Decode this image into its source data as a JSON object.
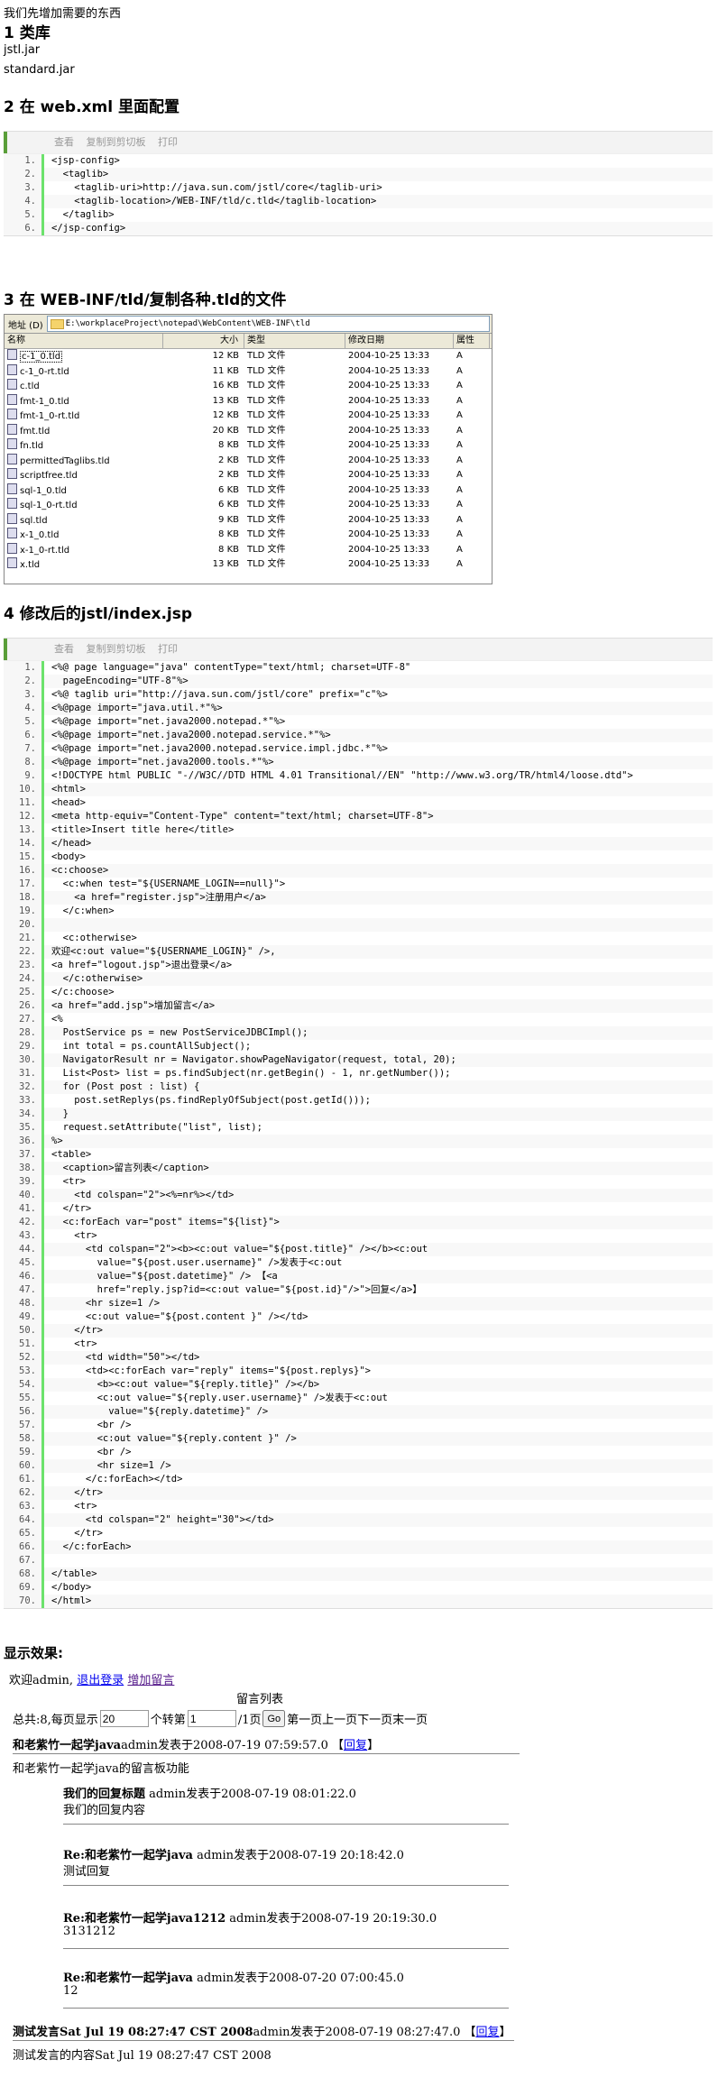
{
  "intro": "我们先增加需要的东西",
  "sec1": {
    "title": "1 类库",
    "items": [
      "jstl.jar",
      "standard.jar"
    ]
  },
  "sec2": {
    "title": "2 在 web.xml 里面配置"
  },
  "toolbar": {
    "view": "查看",
    "copy": "复制到剪切板",
    "print": "打印"
  },
  "webxml": [
    "<jsp-config>",
    "  <taglib>",
    "    <taglib-uri>http://java.sun.com/jstl/core</taglib-uri>",
    "    <taglib-location>/WEB-INF/tld/c.tld</taglib-location>",
    "  </taglib>",
    "</jsp-config>"
  ],
  "sec3": {
    "title": "3 在 WEB-INF/tld/复制各种.tld的文件"
  },
  "explorer": {
    "address_label": "地址 (D)",
    "address": "E:\\workplaceProject\\notepad\\WebContent\\WEB-INF\\tld",
    "columns": [
      "名称",
      "大小",
      "类型",
      "修改日期",
      "属性"
    ],
    "files": [
      [
        "c-1_0.tld",
        "12 KB",
        "TLD 文件",
        "2004-10-25 13:33",
        "A"
      ],
      [
        "c-1_0-rt.tld",
        "11 KB",
        "TLD 文件",
        "2004-10-25 13:33",
        "A"
      ],
      [
        "c.tld",
        "16 KB",
        "TLD 文件",
        "2004-10-25 13:33",
        "A"
      ],
      [
        "fmt-1_0.tld",
        "13 KB",
        "TLD 文件",
        "2004-10-25 13:33",
        "A"
      ],
      [
        "fmt-1_0-rt.tld",
        "12 KB",
        "TLD 文件",
        "2004-10-25 13:33",
        "A"
      ],
      [
        "fmt.tld",
        "20 KB",
        "TLD 文件",
        "2004-10-25 13:33",
        "A"
      ],
      [
        "fn.tld",
        "8 KB",
        "TLD 文件",
        "2004-10-25 13:33",
        "A"
      ],
      [
        "permittedTaglibs.tld",
        "2 KB",
        "TLD 文件",
        "2004-10-25 13:33",
        "A"
      ],
      [
        "scriptfree.tld",
        "2 KB",
        "TLD 文件",
        "2004-10-25 13:33",
        "A"
      ],
      [
        "sql-1_0.tld",
        "6 KB",
        "TLD 文件",
        "2004-10-25 13:33",
        "A"
      ],
      [
        "sql-1_0-rt.tld",
        "6 KB",
        "TLD 文件",
        "2004-10-25 13:33",
        "A"
      ],
      [
        "sql.tld",
        "9 KB",
        "TLD 文件",
        "2004-10-25 13:33",
        "A"
      ],
      [
        "x-1_0.tld",
        "8 KB",
        "TLD 文件",
        "2004-10-25 13:33",
        "A"
      ],
      [
        "x-1_0-rt.tld",
        "8 KB",
        "TLD 文件",
        "2004-10-25 13:33",
        "A"
      ],
      [
        "x.tld",
        "13 KB",
        "TLD 文件",
        "2004-10-25 13:33",
        "A"
      ]
    ]
  },
  "sec4": {
    "title": "4 修改后的jstl/index.jsp"
  },
  "jsp": [
    "<%@ page language=\"java\" contentType=\"text/html; charset=UTF-8\"",
    "  pageEncoding=\"UTF-8\"%>",
    "<%@ taglib uri=\"http://java.sun.com/jstl/core\" prefix=\"c\"%>",
    "<%@page import=\"java.util.*\"%>",
    "<%@page import=\"net.java2000.notepad.*\"%>",
    "<%@page import=\"net.java2000.notepad.service.*\"%>",
    "<%@page import=\"net.java2000.notepad.service.impl.jdbc.*\"%>",
    "<%@page import=\"net.java2000.tools.*\"%>",
    "<!DOCTYPE html PUBLIC \"-//W3C//DTD HTML 4.01 Transitional//EN\" \"http://www.w3.org/TR/html4/loose.dtd\">",
    "<html>",
    "<head>",
    "<meta http-equiv=\"Content-Type\" content=\"text/html; charset=UTF-8\">",
    "<title>Insert title here</title>",
    "</head>",
    "<body>",
    "<c:choose>",
    "  <c:when test=\"${USERNAME_LOGIN==null}\">",
    "    <a href=\"register.jsp\">注册用户</a>",
    "  </c:when>",
    "",
    "  <c:otherwise>",
    "欢迎<c:out value=\"${USERNAME_LOGIN}\" />,",
    "<a href=\"logout.jsp\">退出登录</a>",
    "  </c:otherwise>",
    "</c:choose>",
    "<a href=\"add.jsp\">增加留言</a>",
    "<%",
    "  PostService ps = new PostServiceJDBCImpl();",
    "  int total = ps.countAllSubject();",
    "  NavigatorResult nr = Navigator.showPageNavigator(request, total, 20);",
    "  List<Post> list = ps.findSubject(nr.getBegin() - 1, nr.getNumber());",
    "  for (Post post : list) {",
    "    post.setReplys(ps.findReplyOfSubject(post.getId()));",
    "  }",
    "  request.setAttribute(\"list\", list);",
    "%>",
    "<table>",
    "  <caption>留言列表</caption>",
    "  <tr>",
    "    <td colspan=\"2\"><%=nr%></td>",
    "  </tr>",
    "  <c:forEach var=\"post\" items=\"${list}\">",
    "    <tr>",
    "      <td colspan=\"2\"><b><c:out value=\"${post.title}\" /></b><c:out",
    "        value=\"${post.user.username}\" />发表于<c:out",
    "        value=\"${post.datetime}\" /> 【<a",
    "        href=\"reply.jsp?id=<c:out value=\"${post.id}\"/>\">回复</a>】",
    "      <hr size=1 />",
    "      <c:out value=\"${post.content }\" /></td>",
    "    </tr>",
    "    <tr>",
    "      <td width=\"50\"></td>",
    "      <td><c:forEach var=\"reply\" items=\"${post.replys}\">",
    "        <b><c:out value=\"${reply.title}\" /></b>",
    "        <c:out value=\"${reply.user.username}\" />发表于<c:out",
    "          value=\"${reply.datetime}\" />",
    "        <br />",
    "        <c:out value=\"${reply.content }\" />",
    "        <br />",
    "        <hr size=1 />",
    "      </c:forEach></td>",
    "    </tr>",
    "    <tr>",
    "      <td colspan=\"2\" height=\"30\"></td>",
    "    </tr>",
    "  </c:forEach>",
    "",
    "</table>",
    "</body>",
    "</html>"
  ],
  "sec5": {
    "title": "显示效果:"
  },
  "result": {
    "welcome": "欢迎admin,",
    "logout": "退出登录",
    "add": "增加留言",
    "caption": "留言列表",
    "nav_prefix": "总共:8,每页显示",
    "per_page": "20",
    "nav_goto": "个转第",
    "page": "1",
    "nav_total": "/1页",
    "go": "Go",
    "nav_links": "第一页上一页下一页末一页",
    "post1": {
      "title": "和老紫竹一起学java",
      "meta": "admin发表于2008-07-19 07:59:57.0 【",
      "reply": "回复",
      "close": "】",
      "content": "和老紫竹一起学java的留言板功能"
    },
    "replies": [
      {
        "title": "我们的回复标题",
        "meta": " admin发表于2008-07-19 08:01:22.0",
        "content": "我们的回复内容"
      },
      {
        "title": "Re:和老紫竹一起学java",
        "meta": " admin发表于2008-07-19 20:18:42.0",
        "content": "测试回复"
      },
      {
        "title": "Re:和老紫竹一起学java1212",
        "meta": " admin发表于2008-07-19 20:19:30.0",
        "content": "3131212"
      },
      {
        "title": "Re:和老紫竹一起学java",
        "meta": " admin发表于2008-07-20 07:00:45.0",
        "content": "12"
      }
    ],
    "post2": {
      "title": "测试发言Sat Jul 19 08:27:47 CST 2008",
      "meta": "admin发表于2008-07-19 08:27:47.0 【",
      "reply": "回复",
      "close": "】",
      "content": "测试发言的内容Sat Jul 19 08:27:47 CST 2008"
    }
  }
}
